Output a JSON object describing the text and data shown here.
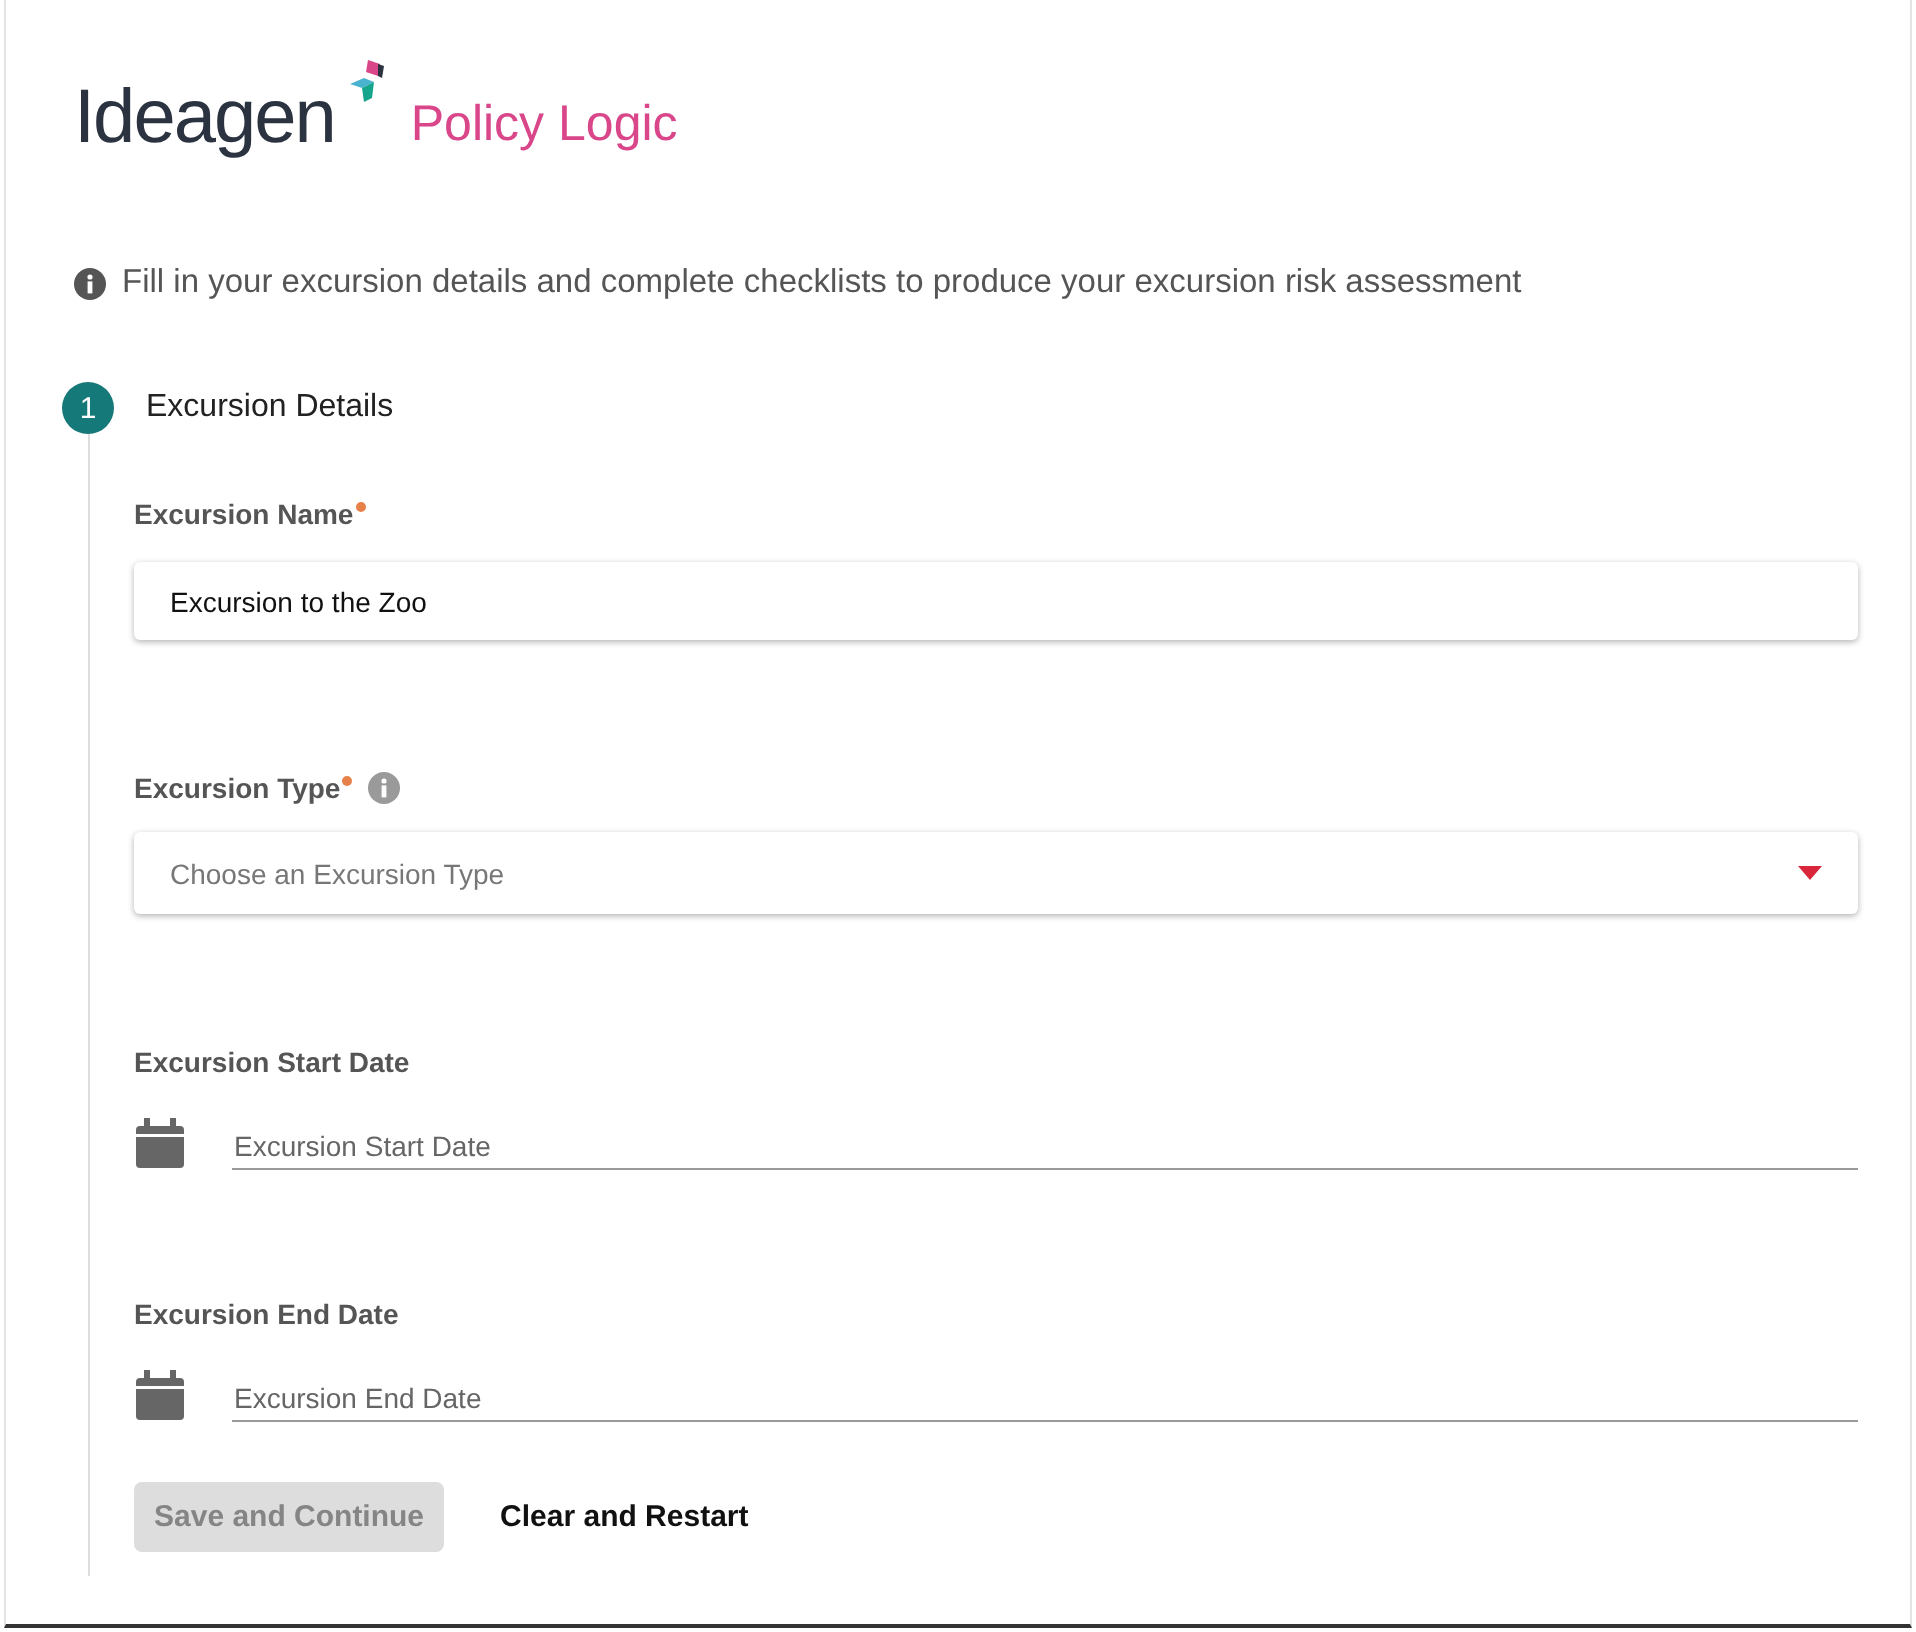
{
  "logo": {
    "brand": "Ideagen",
    "product": "Policy Logic"
  },
  "info": "Fill in your excursion details and complete checklists to produce your excursion risk assessment",
  "step": {
    "number": "1",
    "title": "Excursion Details"
  },
  "fields": [
    {
      "kind": "text",
      "label": "Excursion Name",
      "required": true,
      "info": false,
      "value": "Excursion to the Zoo"
    },
    {
      "kind": "select",
      "label": "Excursion Type",
      "required": true,
      "info": true,
      "placeholder": "Choose an Excursion Type"
    },
    {
      "kind": "date",
      "label": "Excursion Start Date",
      "required": false,
      "info": false,
      "placeholder": "Excursion Start Date"
    },
    {
      "kind": "date",
      "label": "Excursion End Date",
      "required": false,
      "info": false,
      "placeholder": "Excursion End Date"
    }
  ],
  "buttons": [
    {
      "label": "Save and Continue",
      "disabled": true,
      "kind": "filled"
    },
    {
      "label": "Clear and Restart",
      "disabled": false,
      "kind": "text"
    }
  ]
}
